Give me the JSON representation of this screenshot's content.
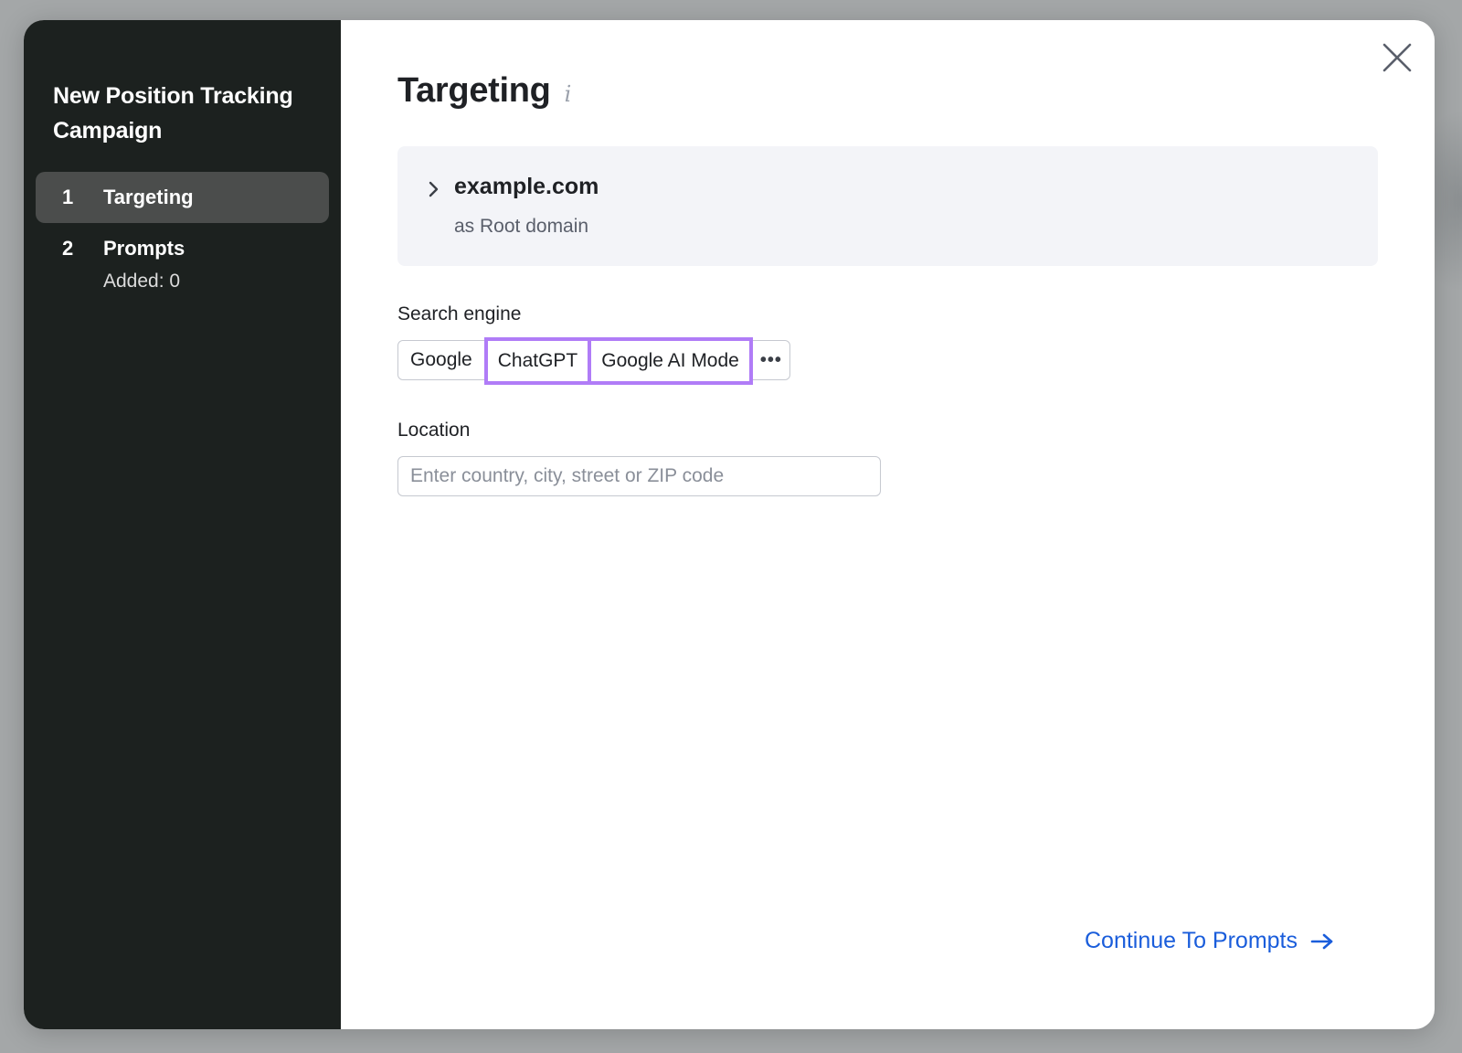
{
  "sidebar": {
    "title": "New Position Tracking Campaign",
    "steps": [
      {
        "number": "1",
        "label": "Targeting",
        "active": true
      },
      {
        "number": "2",
        "label": "Prompts",
        "sub": "Added: 0",
        "active": false
      }
    ]
  },
  "main": {
    "title": "Targeting",
    "info_icon": "i",
    "domain": {
      "name": "example.com",
      "type": "as Root domain"
    },
    "search_engine": {
      "label": "Search engine",
      "options": [
        "Google",
        "ChatGPT",
        "Google AI Mode"
      ],
      "more_label": "•••",
      "highlight_color": "#b07cf7"
    },
    "location": {
      "label": "Location",
      "placeholder": "Enter country, city, street or ZIP code",
      "value": ""
    },
    "continue_label": "Continue To Prompts"
  },
  "colors": {
    "sidebar_bg": "#1c211f",
    "active_step_bg": "#4b4d4c",
    "link": "#1a5ddb",
    "card_bg": "#f3f4f8"
  }
}
